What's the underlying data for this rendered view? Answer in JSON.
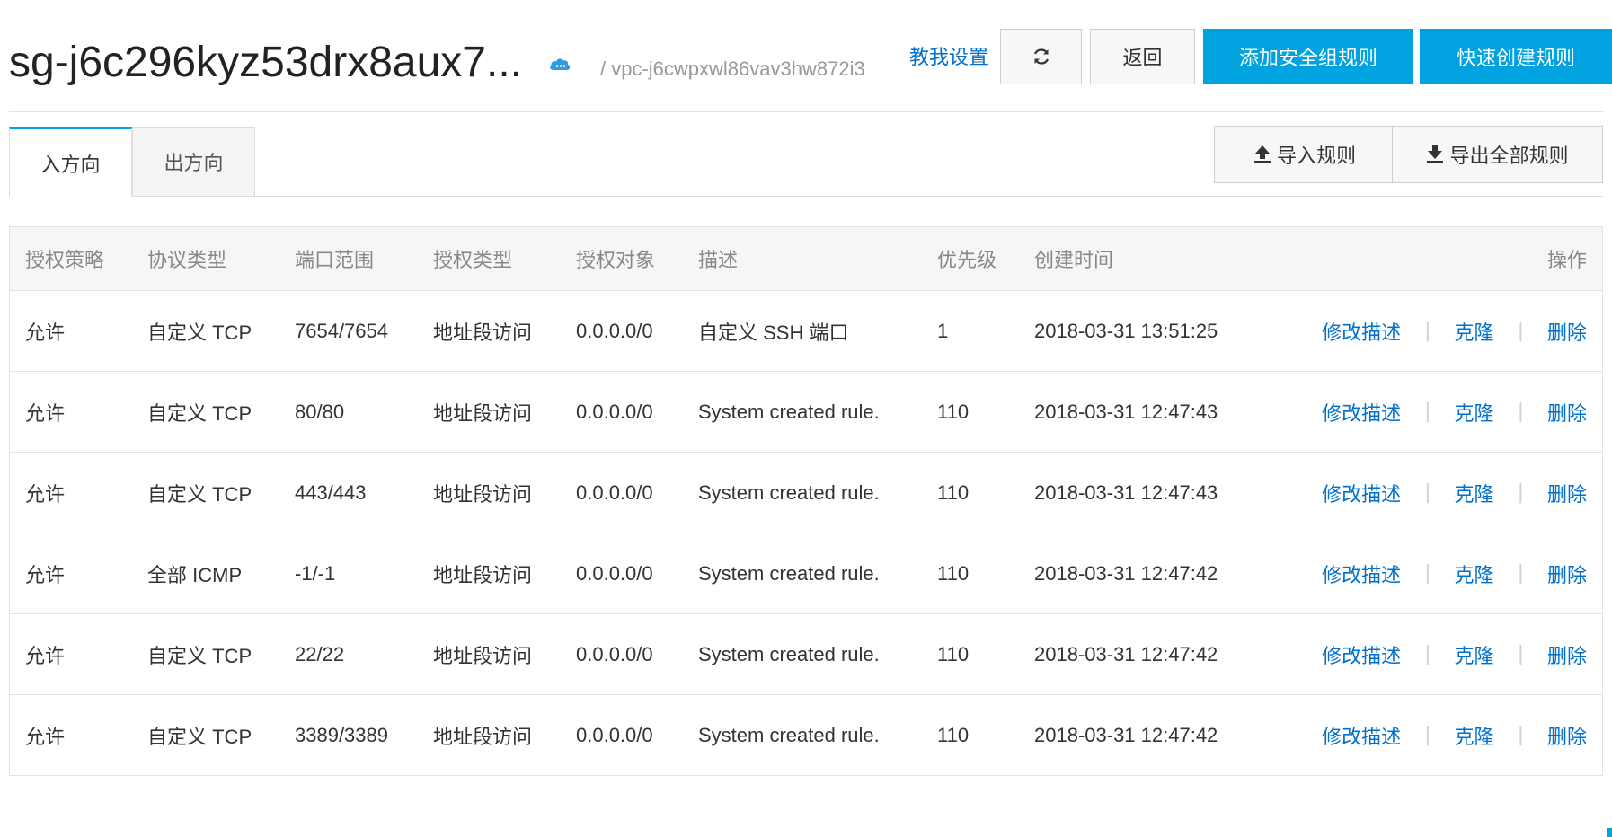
{
  "header": {
    "title": "sg-j6c296kyz53drx8aux7...",
    "vpc": "/ vpc-j6cwpxwl86vav3hw872i3",
    "help_link": "教我设置",
    "back_label": "返回",
    "add_rule_label": "添加安全组规则",
    "quick_create_label": "快速创建规则"
  },
  "tabs": [
    {
      "label": "入方向",
      "active": true
    },
    {
      "label": "出方向",
      "active": false
    }
  ],
  "tools": {
    "import_label": "导入规则",
    "export_label": "导出全部规则"
  },
  "table": {
    "columns": [
      "授权策略",
      "协议类型",
      "端口范围",
      "授权类型",
      "授权对象",
      "描述",
      "优先级",
      "创建时间",
      "操作"
    ],
    "rows": [
      {
        "policy": "允许",
        "protocol": "自定义 TCP",
        "port": "7654/7654",
        "auth_type": "地址段访问",
        "target": "0.0.0.0/0",
        "desc": "自定义 SSH 端口",
        "priority": "1",
        "created": "2018-03-31 13:51:25"
      },
      {
        "policy": "允许",
        "protocol": "自定义 TCP",
        "port": "80/80",
        "auth_type": "地址段访问",
        "target": "0.0.0.0/0",
        "desc": "System created rule.",
        "priority": "110",
        "created": "2018-03-31 12:47:43"
      },
      {
        "policy": "允许",
        "protocol": "自定义 TCP",
        "port": "443/443",
        "auth_type": "地址段访问",
        "target": "0.0.0.0/0",
        "desc": "System created rule.",
        "priority": "110",
        "created": "2018-03-31 12:47:43"
      },
      {
        "policy": "允许",
        "protocol": "全部 ICMP",
        "port": "-1/-1",
        "auth_type": "地址段访问",
        "target": "0.0.0.0/0",
        "desc": "System created rule.",
        "priority": "110",
        "created": "2018-03-31 12:47:42"
      },
      {
        "policy": "允许",
        "protocol": "自定义 TCP",
        "port": "22/22",
        "auth_type": "地址段访问",
        "target": "0.0.0.0/0",
        "desc": "System created rule.",
        "priority": "110",
        "created": "2018-03-31 12:47:42"
      },
      {
        "policy": "允许",
        "protocol": "自定义 TCP",
        "port": "3389/3389",
        "auth_type": "地址段访问",
        "target": "0.0.0.0/0",
        "desc": "System created rule.",
        "priority": "110",
        "created": "2018-03-31 12:47:42"
      }
    ],
    "actions": {
      "edit": "修改描述",
      "clone": "克隆",
      "delete": "删除",
      "separator": "|"
    }
  },
  "colors": {
    "accent": "#00a2e0",
    "link": "#0070cc",
    "header_bg": "#f5f6f8"
  }
}
